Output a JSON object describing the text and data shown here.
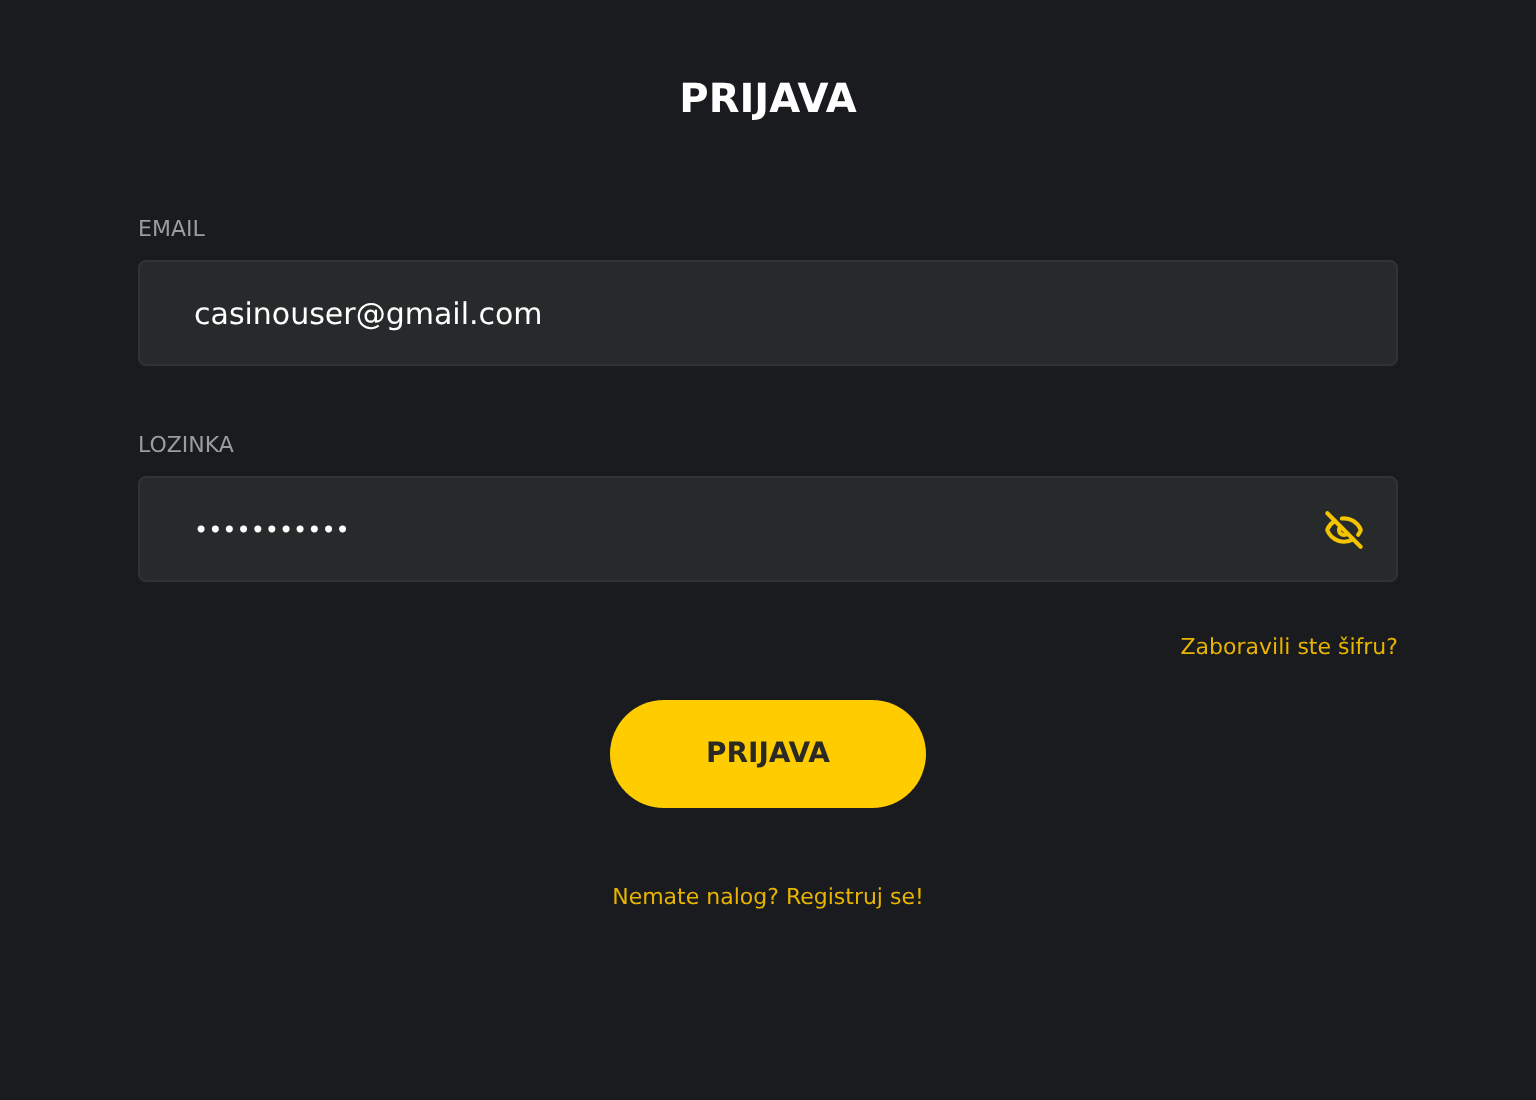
{
  "title": "PRIJAVA",
  "email": {
    "label": "EMAIL",
    "value": "casinouser@gmail.com"
  },
  "password": {
    "label": "LOZINKA",
    "value": "•••••••••••"
  },
  "forgot_link": "Zaboravili ste šifru?",
  "submit_button": "PRIJAVA",
  "register_link": "Nemate nalog? Registruj se!"
}
